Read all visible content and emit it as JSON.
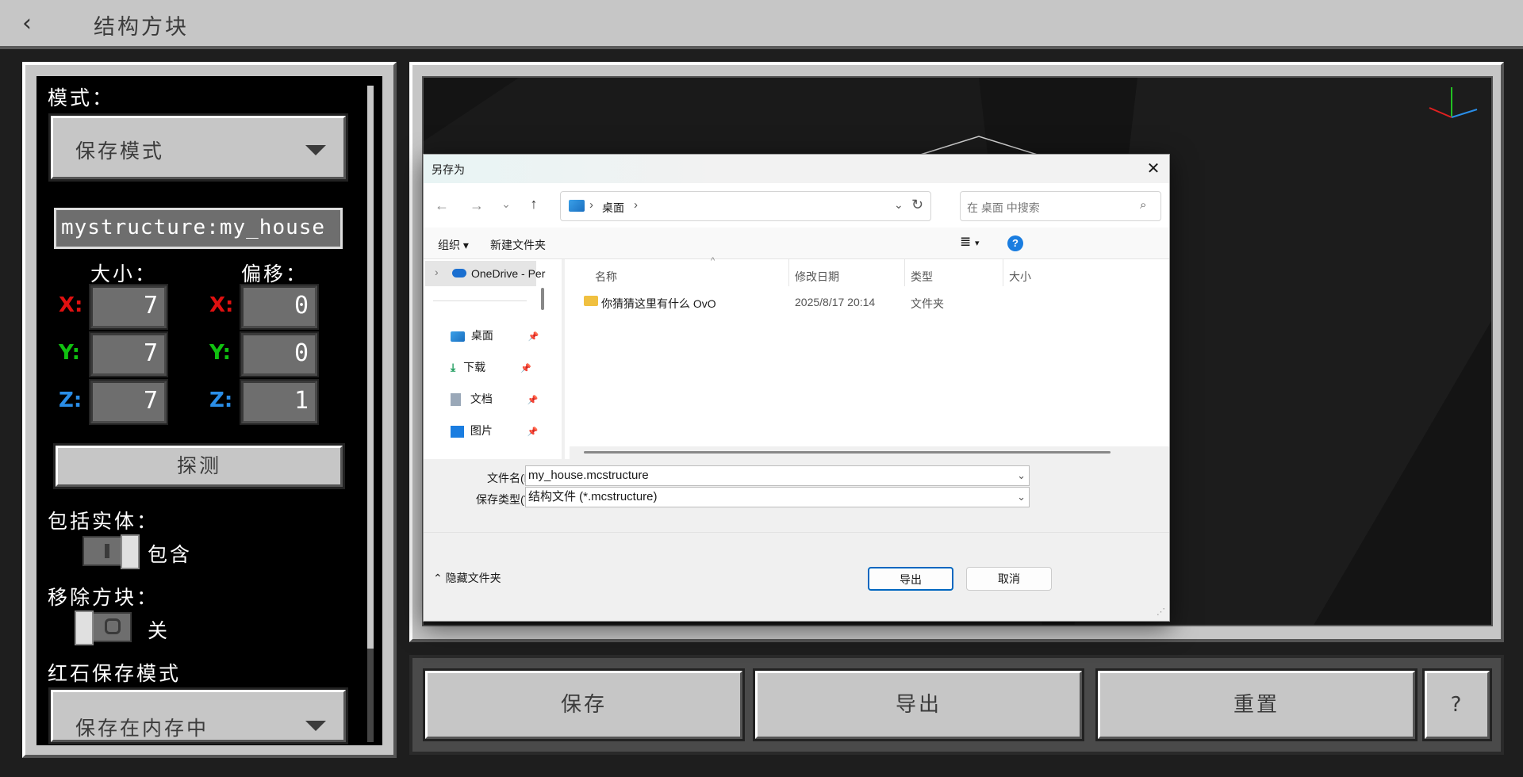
{
  "topbar": {
    "back_icon": "chevron-left-icon",
    "title": "结构方块"
  },
  "left": {
    "mode_label": "模式：",
    "mode_value": "保存模式",
    "structure_name": "mystructure:my_house",
    "size_label": "大小：",
    "offset_label": "偏移：",
    "size": {
      "x": "7",
      "y": "7",
      "z": "7"
    },
    "offset": {
      "x": "0",
      "y": "0",
      "z": "1"
    },
    "axis": {
      "x": "X:",
      "y": "Y:",
      "z": "Z:"
    },
    "detect_label": "探测",
    "include_entities_label": "包括实体：",
    "include_entities_state": "包含",
    "remove_blocks_label": "移除方块：",
    "remove_blocks_state": "关",
    "redstone_label": "红石保存模式",
    "redstone_value": "保存在内存中"
  },
  "bottom": {
    "save": "保存",
    "export": "导出",
    "reset": "重置",
    "help": "?"
  },
  "dialog": {
    "title": "另存为",
    "path_folder": "桌面",
    "search_placeholder": "在 桌面 中搜索",
    "organize": "组织",
    "new_folder": "新建文件夹",
    "nav": {
      "onedrive": "OneDrive - Per",
      "items": [
        {
          "label": "桌面",
          "icon": "desktop-icon"
        },
        {
          "label": "下载",
          "icon": "download-icon"
        },
        {
          "label": "文档",
          "icon": "document-icon"
        },
        {
          "label": "图片",
          "icon": "picture-icon"
        }
      ]
    },
    "columns": {
      "name": "名称",
      "modified": "修改日期",
      "type": "类型",
      "size": "大小"
    },
    "files": [
      {
        "name": "你猜猜这里有什么 OvO",
        "modified": "2025/8/17 20:14",
        "type": "文件夹"
      }
    ],
    "filename_label": "文件名(N):",
    "filename_value": "my_house.mcstructure",
    "filetype_label": "保存类型(T):",
    "filetype_value": "结构文件 (*.mcstructure)",
    "hide_folders": "隐藏文件夹",
    "export_btn": "导出",
    "cancel_btn": "取消"
  },
  "colors": {
    "x_axis": "#e01010",
    "y_axis": "#10c010",
    "z_axis": "#2a8ee8",
    "mc_gray": "#c6c6c6",
    "win_accent": "#0067c0"
  }
}
